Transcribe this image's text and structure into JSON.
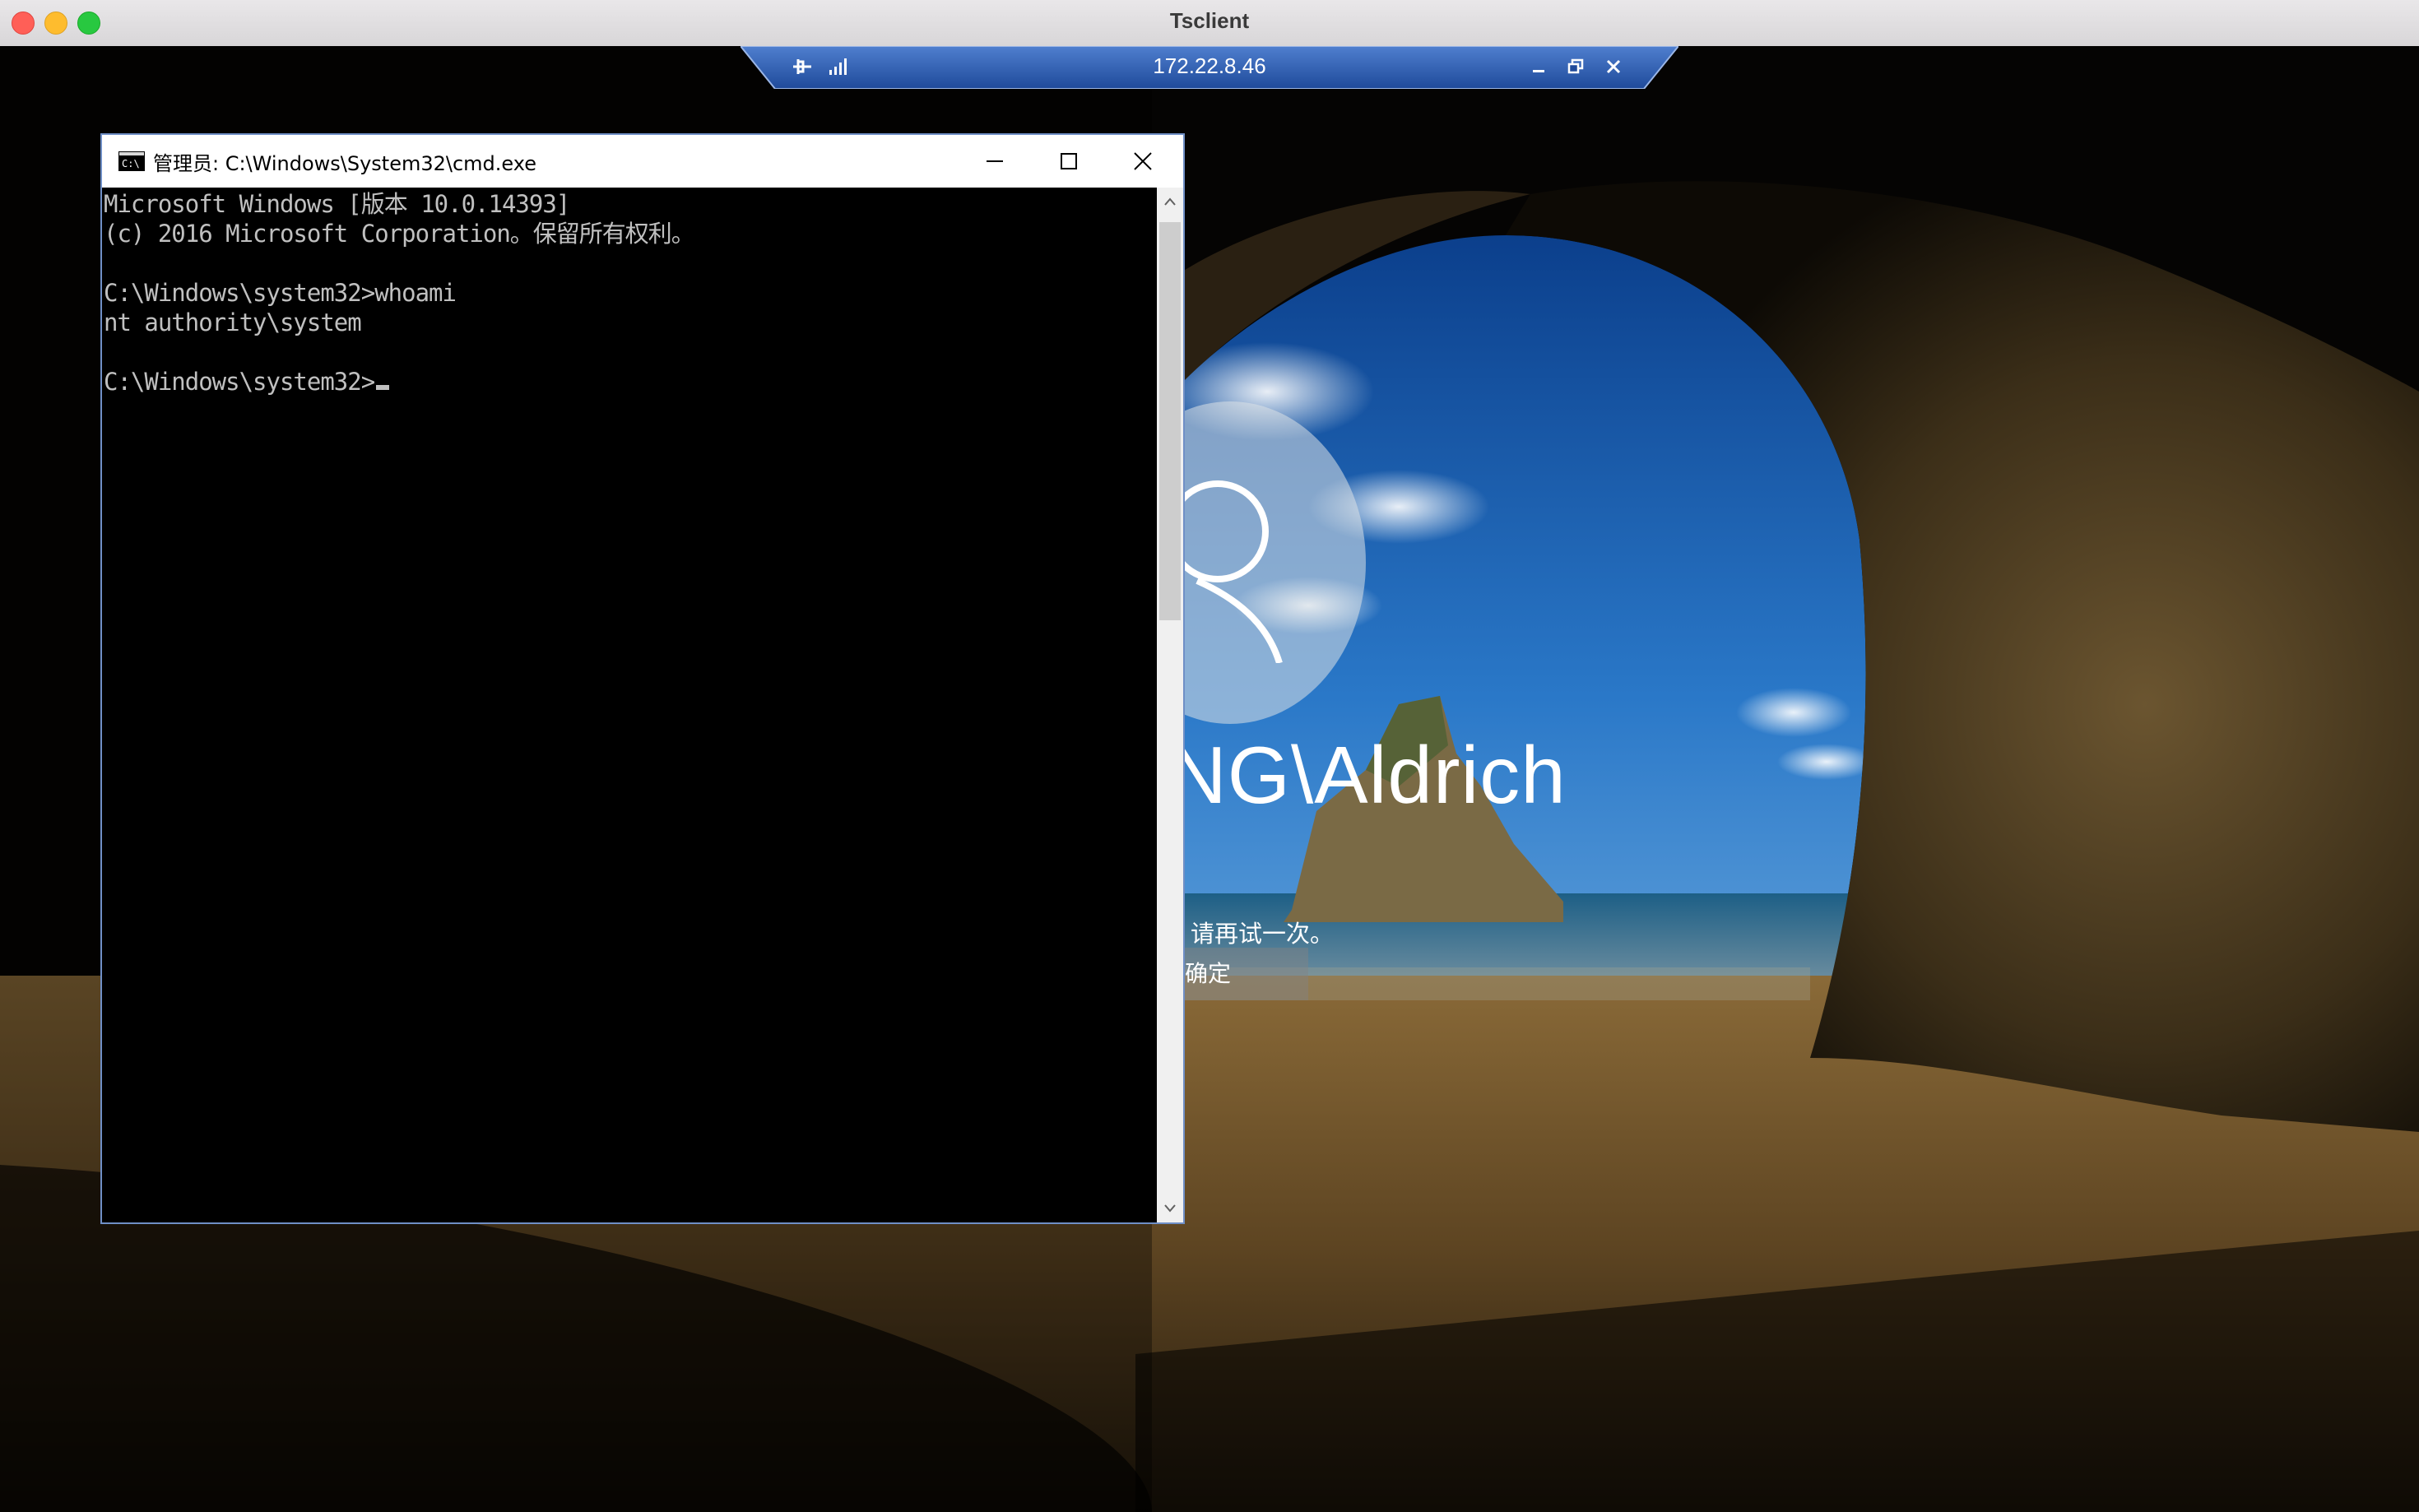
{
  "mac_window": {
    "title": "Tsclient"
  },
  "rdp_bar": {
    "host": "172.22.8.46",
    "icons": [
      "pin-icon",
      "signal-bars-icon",
      "minimize-icon",
      "restore-icon",
      "close-icon"
    ]
  },
  "cmd": {
    "title": "管理员: C:\\Windows\\System32\\cmd.exe",
    "lines": [
      "Microsoft Windows [版本 10.0.14393]",
      "(c) 2016 Microsoft Corporation。保留所有权利。",
      "",
      "C:\\Windows\\system32>whoami",
      "nt authority\\system",
      "",
      "C:\\Windows\\system32>"
    ],
    "controls": [
      "minimize-icon",
      "maximize-icon",
      "close-icon"
    ]
  },
  "login_screen": {
    "username": "NG\\Aldrich",
    "message": "。请再试一次。",
    "ok_button": "确定"
  },
  "colors": {
    "rdp_bar": "#2b58a8",
    "cmd_border": "#6f8fc6",
    "console_text": "#c0c0c0"
  }
}
